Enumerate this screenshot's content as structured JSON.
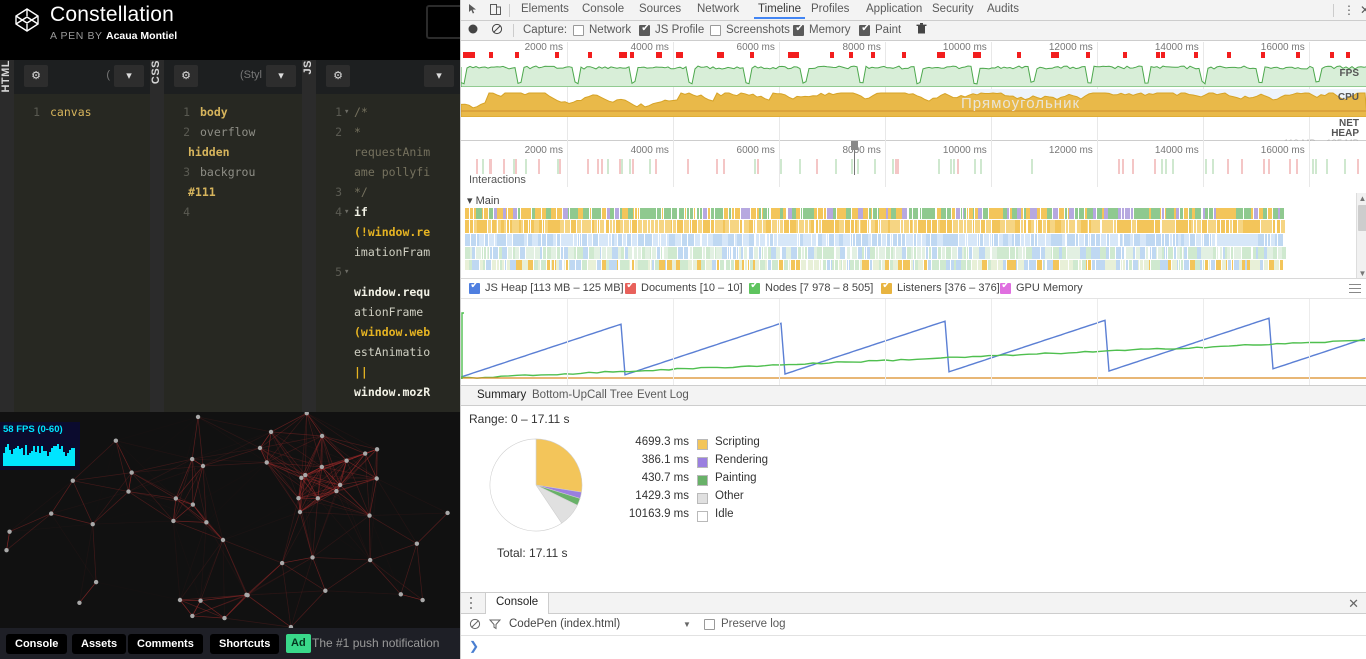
{
  "codepen": {
    "title": "Constellation",
    "byline_prefix": "A PEN BY",
    "author": "Acaua Montiel",
    "logo_icon": "codepen-logo-icon",
    "editors": [
      {
        "tab": "HTML",
        "gear": "gear-icon",
        "caret": "chevron-down-icon",
        "name": "(",
        "lines": [
          {
            "no": "1",
            "segs": [
              {
                "t": "canvas",
                "c": "k-sel"
              }
            ]
          }
        ]
      },
      {
        "tab": "CSS",
        "gear": "gear-icon",
        "caret": "chevron-down-icon",
        "name": "(Styl",
        "lines": [
          {
            "no": "1",
            "segs": [
              {
                "t": "body",
                "c": "k-sel"
              }
            ]
          },
          {
            "no": "2",
            "segs": [
              {
                "t": "  overflow",
                "c": "k-prop"
              }
            ]
          },
          {
            "no": "",
            "segs": [
              {
                "t": "hidden",
                "c": "k-val"
              }
            ]
          },
          {
            "no": "3",
            "segs": [
              {
                "t": "  backgrou",
                "c": "k-prop"
              }
            ]
          },
          {
            "no": "",
            "segs": [
              {
                "t": "#111",
                "c": "k-val"
              }
            ]
          },
          {
            "no": "4",
            "segs": []
          }
        ]
      },
      {
        "tab": "JS",
        "gear": "gear-icon",
        "caret": "chevron-down-icon",
        "name": "",
        "lines": [
          {
            "no": "1",
            "fold": true,
            "segs": [
              {
                "t": "/*",
                "c": "k-com"
              }
            ]
          },
          {
            "no": "2",
            "segs": [
              {
                "t": " *",
                "c": "k-com"
              }
            ]
          },
          {
            "no": "",
            "segs": [
              {
                "t": "requestAnim",
                "c": "k-com"
              }
            ]
          },
          {
            "no": "",
            "segs": [
              {
                "t": "ame pollyfi",
                "c": "k-com"
              }
            ]
          },
          {
            "no": "3",
            "segs": [
              {
                "t": " */",
                "c": "k-com"
              }
            ]
          },
          {
            "no": "4",
            "fold": true,
            "segs": [
              {
                "t": "if",
                "c": "k-kw"
              }
            ]
          },
          {
            "no": "",
            "segs": [
              {
                "t": "(!window.re",
                "c": "k-pun"
              }
            ]
          },
          {
            "no": "",
            "segs": [
              {
                "t": "imationFram",
                "c": "k-id"
              }
            ]
          },
          {
            "no": "5",
            "fold": true,
            "segs": []
          },
          {
            "no": "",
            "segs": [
              {
                "t": "window.requ",
                "c": "k-kw"
              }
            ]
          },
          {
            "no": "",
            "segs": [
              {
                "t": "ationFrame",
                "c": "k-id"
              }
            ]
          },
          {
            "no": "",
            "segs": [
              {
                "t": "(window.web",
                "c": "k-pun"
              }
            ]
          },
          {
            "no": "",
            "segs": [
              {
                "t": "estAnimatio",
                "c": "k-id"
              }
            ]
          },
          {
            "no": "",
            "segs": [
              {
                "t": "||",
                "c": "k-pun"
              }
            ]
          },
          {
            "no": "",
            "segs": [
              {
                "t": "window.mozR",
                "c": "k-kw"
              }
            ]
          }
        ]
      }
    ],
    "preview": {
      "fps_label": "58 FPS (0-60)",
      "accent": "#00e5ff",
      "bg": "#111",
      "particle_color": "#b03030"
    },
    "footer": {
      "buttons": [
        "Console",
        "Assets",
        "Comments",
        "Shortcuts"
      ],
      "ad_badge": "Ad",
      "ad_text": "The #1 push notification"
    }
  },
  "devtools": {
    "tabs": [
      "Elements",
      "Console",
      "Sources",
      "Network",
      "Timeline",
      "Profiles",
      "Application",
      "Security",
      "Audits"
    ],
    "selected_tab": "Timeline",
    "left_icons": [
      "inspect-icon",
      "device-toolbar-icon"
    ],
    "right_icons": [
      "more-options-icon",
      "close-icon"
    ],
    "toolbar": {
      "record_icon": "record-icon",
      "clear_icon": "clear-icon",
      "trash_icon": "trash-icon",
      "capture_label": "Capture:",
      "options": [
        {
          "label": "Network",
          "checked": false
        },
        {
          "label": "JS Profile",
          "checked": true
        },
        {
          "label": "Screenshots",
          "checked": false
        },
        {
          "label": "Memory",
          "checked": true
        },
        {
          "label": "Paint",
          "checked": true
        }
      ]
    },
    "overview": {
      "ticks": [
        "2000 ms",
        "4000 ms",
        "6000 ms",
        "8000 ms",
        "10000 ms",
        "12000 ms",
        "14000 ms",
        "16000 ms"
      ],
      "lanes": [
        "FPS",
        "CPU",
        "NET",
        "HEAP"
      ],
      "heap_range": "113 MB – 125 MB",
      "watermark": "Прямоугольник",
      "frame_marker_color": "#f21e1e",
      "fps_color": "#5ab85a",
      "cpu_color": "#e8b440",
      "heap_color": "#9ab4e8"
    },
    "timeline": {
      "ticks": [
        "2000 ms",
        "4000 ms",
        "6000 ms",
        "8000 ms",
        "10000 ms",
        "12000 ms",
        "14000 ms",
        "16000 ms"
      ],
      "interactions_label": "Interactions",
      "main_label": "Main",
      "main_expand_icon": "triangle-down-icon"
    },
    "counters": {
      "legend": [
        {
          "label": "JS Heap [113 MB – 125 MB]",
          "color": "#4f7fe0",
          "checked": true
        },
        {
          "label": "Documents [10 – 10]",
          "color": "#e8615b",
          "checked": true
        },
        {
          "label": "Nodes [7 978 – 8 505]",
          "color": "#5ec45e",
          "checked": true
        },
        {
          "label": "Listeners [376 – 376]",
          "color": "#e8b440",
          "checked": true
        },
        {
          "label": "GPU Memory",
          "color": "#e06fe0",
          "checked": true
        }
      ],
      "menu_icon": "hamburger-icon"
    },
    "details": {
      "tabs": [
        "Summary",
        "Bottom-Up",
        "Call Tree",
        "Event Log"
      ],
      "selected_tab": "Summary",
      "range_label": "Range: 0 – 17.11 s",
      "total_label": "Total: 17.11 s"
    },
    "drawer": {
      "menu_icon": "vertical-dots-icon",
      "tab": "Console",
      "close_icon": "close-icon",
      "clear_icon": "ban-icon",
      "filter_icon": "funnel-icon",
      "context": "CodePen (index.html)",
      "context_caret": "caret-down-icon",
      "preserve_log": "Preserve log",
      "preserve_log_checked": false,
      "prompt": "❯"
    }
  },
  "chart_data": {
    "type": "pie",
    "title": "Range: 0 – 17.11 s",
    "unit": "ms",
    "total_label": "Total: 17.11 s",
    "categories": [
      "Scripting",
      "Rendering",
      "Painting",
      "Other",
      "Idle"
    ],
    "values": [
      4699.3,
      386.1,
      430.7,
      1429.3,
      10163.9
    ],
    "value_labels": [
      "4699.3 ms",
      "386.1 ms",
      "430.7 ms",
      "1429.3 ms",
      "10163.9 ms"
    ],
    "colors": [
      "#f3c55a",
      "#9a7fe0",
      "#68b168",
      "#e0e0e0",
      "#ffffff"
    ],
    "legend": "right"
  }
}
